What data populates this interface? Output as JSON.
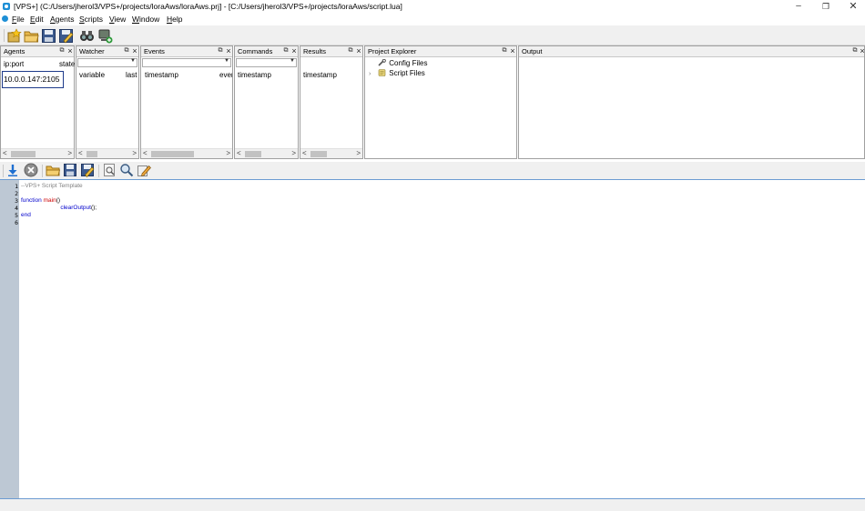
{
  "window": {
    "title": "[VPS+] (C:/Users/jherol3/VPS+/projects/loraAws/loraAws.prj] - [C:/Users/jherol3/VPS+/projects/loraAws/script.lua]",
    "minimize": "–",
    "maximize": "❐",
    "close": "✕"
  },
  "menu": {
    "items": [
      {
        "label_ul": "F",
        "label_rest": "ile"
      },
      {
        "label_ul": "E",
        "label_rest": "dit"
      },
      {
        "label_ul": "A",
        "label_rest": "gents"
      },
      {
        "label_ul": "S",
        "label_rest": "cripts"
      },
      {
        "label_ul": "V",
        "label_rest": "iew"
      },
      {
        "label_ul": "W",
        "label_rest": "indow"
      },
      {
        "label_ul": "H",
        "label_rest": "elp"
      }
    ]
  },
  "toolbar_icons": [
    "new-project-icon",
    "open-folder-icon",
    "save-icon",
    "save-as-icon",
    "connect-agents-icon",
    "network-agent-icon"
  ],
  "docks": {
    "agents": {
      "title": "Agents",
      "col1": "ip:port",
      "col2": "state",
      "row": "10.0.0.147:2105"
    },
    "watcher": {
      "title": "Watcher",
      "col1": "variable",
      "col2": "last"
    },
    "events": {
      "title": "Events",
      "col1": "timestamp",
      "col2": "event"
    },
    "commands": {
      "title": "Commands",
      "col1": "timestamp"
    },
    "results": {
      "title": "Results",
      "col1": "timestamp"
    },
    "project_explorer": {
      "title": "Project Explorer",
      "items": [
        "Config Files",
        "Script Files"
      ]
    },
    "output": {
      "title": "Output"
    }
  },
  "dock_controls": {
    "float": "⧉",
    "close": "×",
    "scroll_left": "<",
    "scroll_right": ">",
    "combo_arrow": "▼"
  },
  "editor_toolbar_icons": [
    "upload-script-icon",
    "stop-icon",
    "open-script-icon",
    "save-script-icon",
    "save-script-as-icon",
    "preview-icon",
    "find-icon",
    "edit-icon"
  ],
  "editor": {
    "line_numbers": [
      "1",
      "2",
      "3",
      "4",
      "5",
      "6"
    ],
    "line1_comment": "--VPS+ Script Template",
    "line3_kw": "function",
    "line3_fn": "main",
    "line3_paren": "()",
    "line4_indent": "                        ",
    "line4_call": "clearOutput",
    "line4_rest": "();",
    "line5_kw": "end"
  },
  "colors": {
    "accent": "#1e8fd6",
    "gutter": "#bdc8d4",
    "keyword": "#0000cc",
    "function_name": "#cc0000",
    "comment": "#808080"
  }
}
